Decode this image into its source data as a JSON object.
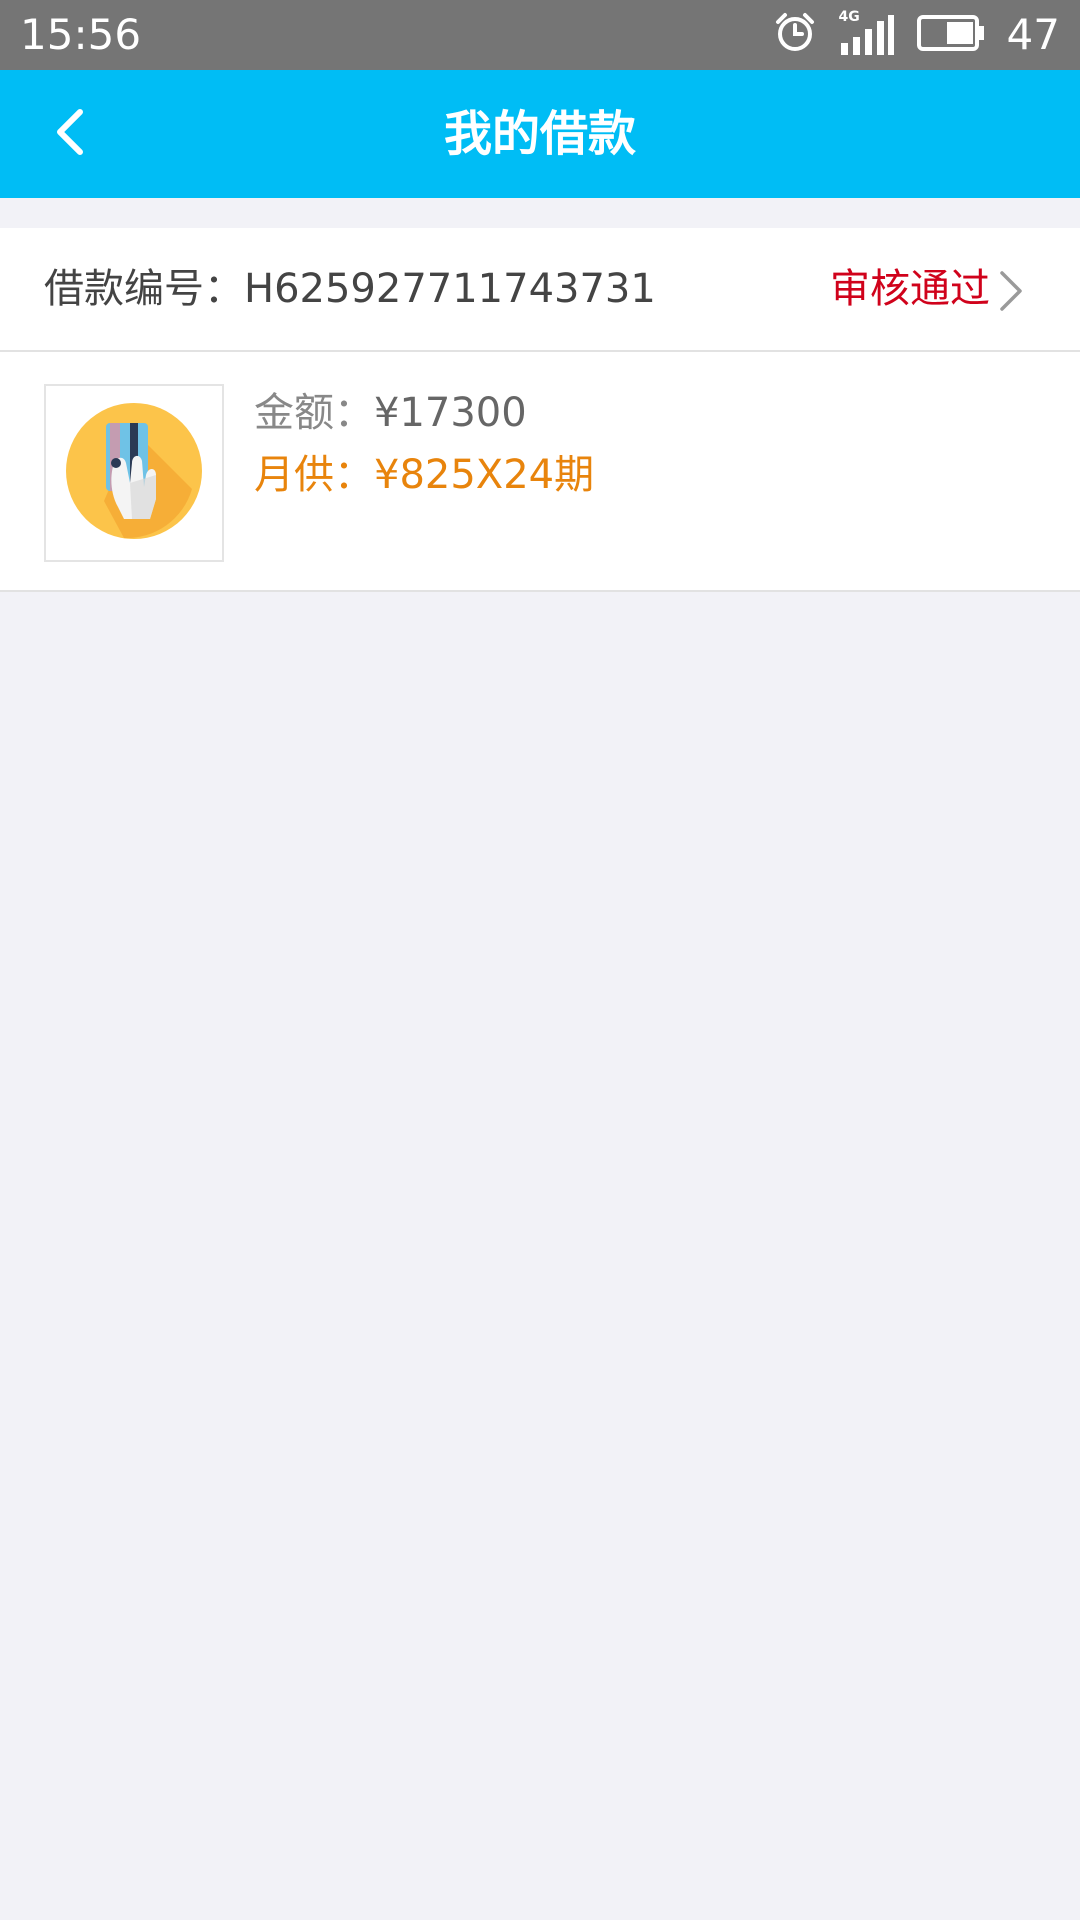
{
  "status_bar": {
    "time": "15:56",
    "network": "4G",
    "battery_level": "47",
    "icons": [
      "alarm-icon",
      "signal-icon",
      "battery-icon"
    ]
  },
  "header": {
    "title": "我的借款",
    "back_icon": "chevron-left-icon",
    "background_color": "#00bdf5"
  },
  "loan": {
    "number_label": "借款编号：",
    "number": "H625927711743731",
    "status": "审核通过",
    "status_color": "#d0021b",
    "amount_label": "金额：",
    "amount": "¥17300",
    "monthly_label": "月供：",
    "monthly": "¥825X24期",
    "monthly_color": "#e8840c",
    "thumbnail_icon": "credit-card-hand-icon"
  }
}
